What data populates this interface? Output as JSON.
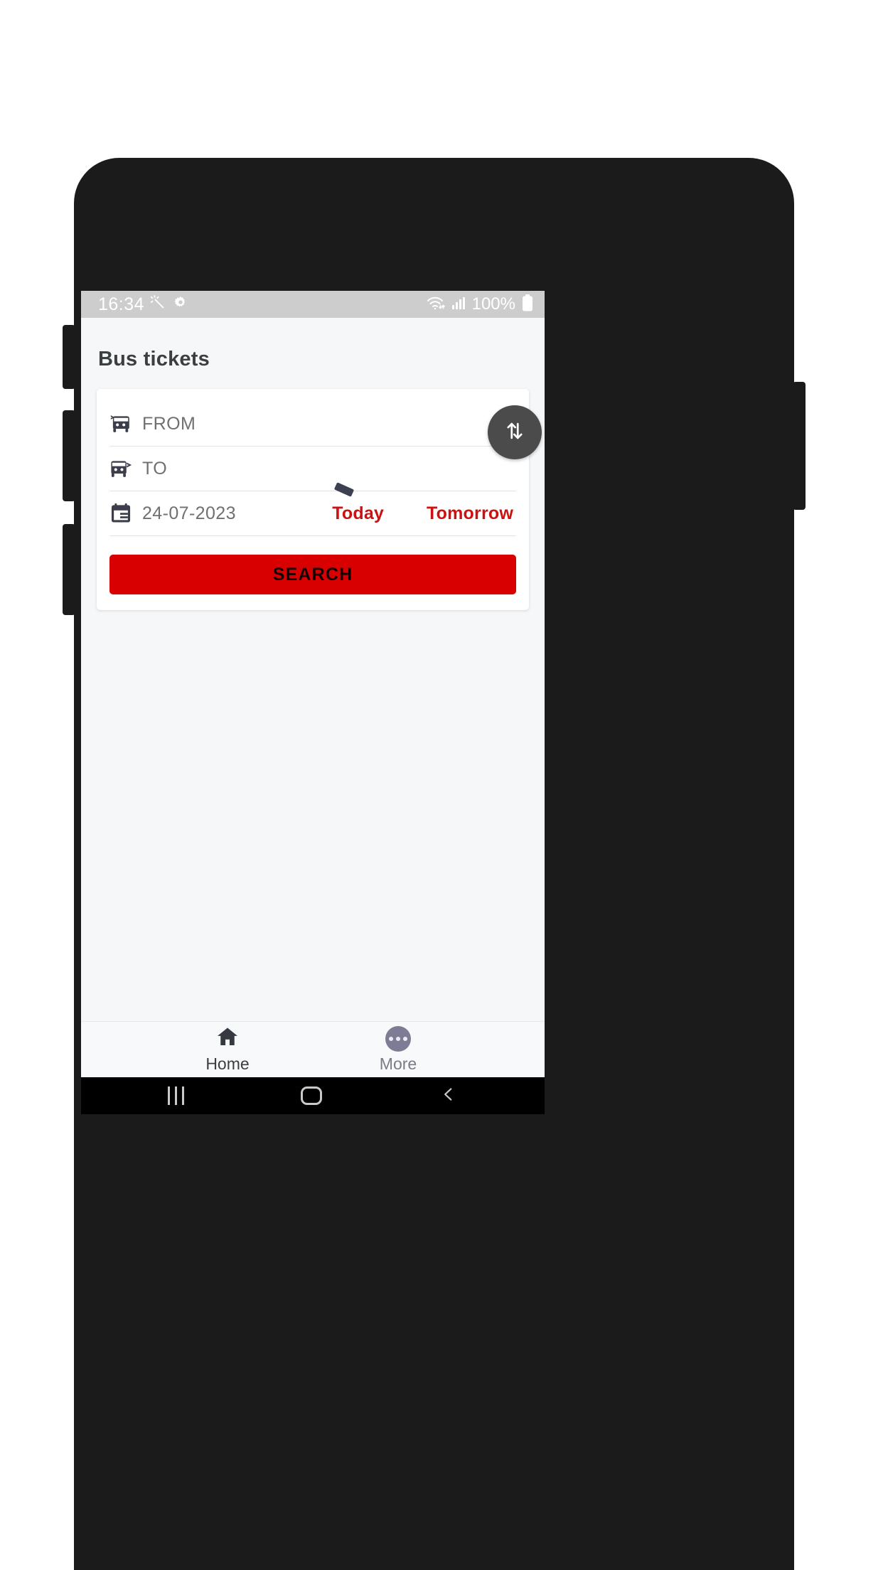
{
  "status_bar": {
    "time": "16:34",
    "left_icons": [
      "magic-wand-icon",
      "gear-icon"
    ],
    "right_icons": [
      "wifi-icon",
      "signal-bars-icon",
      "battery-icon"
    ],
    "battery_text": "100%"
  },
  "app": {
    "title": "Bus tickets",
    "accent_red": "#d80000",
    "quick_date_red": "#cc1111",
    "background": "#f5f7f9"
  },
  "search_card": {
    "from": {
      "icon": "bus-departure-icon",
      "placeholder": "FROM",
      "value": ""
    },
    "to": {
      "icon": "bus-arrival-icon",
      "placeholder": "TO",
      "value": ""
    },
    "date": {
      "icon": "calendar-icon",
      "value": "24-07-2023"
    },
    "quick_dates": [
      {
        "label": "Today"
      },
      {
        "label": "Tomorrow"
      }
    ],
    "swap_button": {
      "icon": "swap-vertical-arrows-icon",
      "color": "#4b4b4b"
    },
    "search_button": {
      "label": "SEARCH"
    }
  },
  "bottom_nav": {
    "items": [
      {
        "label": "Home",
        "icon": "home-icon",
        "active": true
      },
      {
        "label": "More",
        "icon": "more-dots-icon",
        "active": false
      }
    ]
  },
  "android_nav": {
    "items": [
      "recents-icon",
      "home-icon",
      "back-icon"
    ]
  }
}
